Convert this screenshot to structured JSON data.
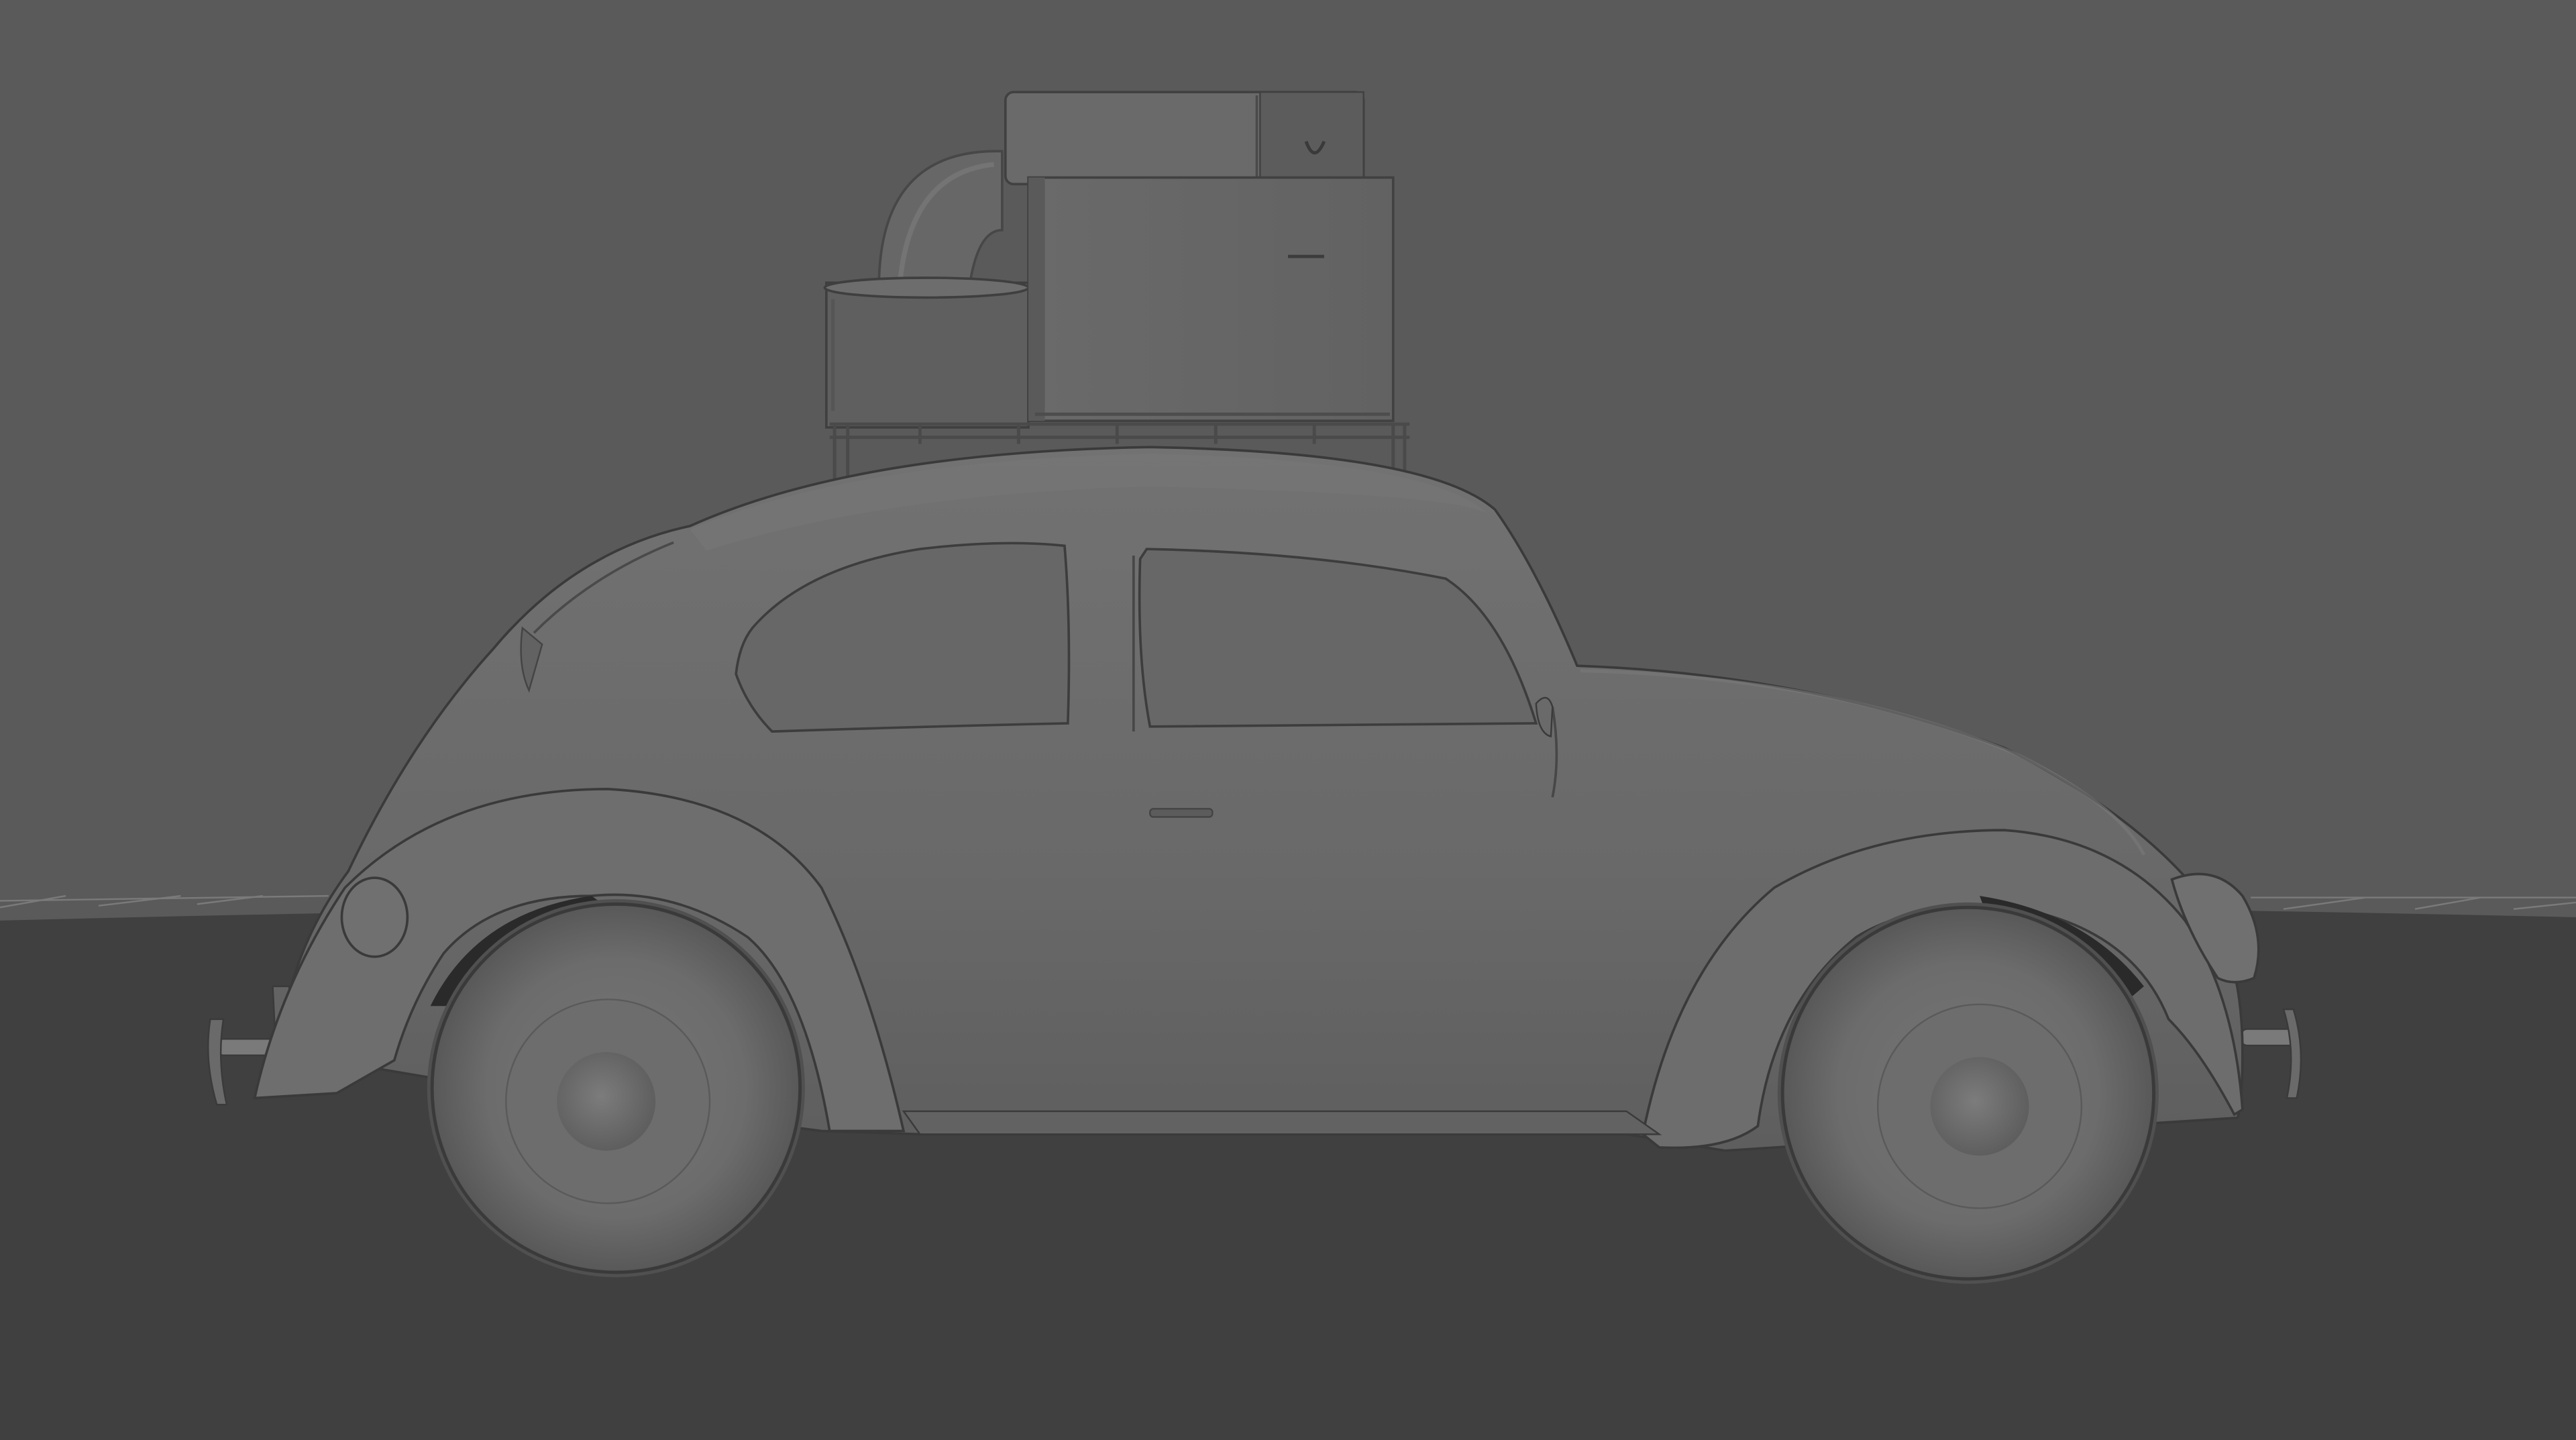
{
  "viewport": {
    "view": "side",
    "shading": "smooth-shade-all",
    "colors": {
      "background": "#5a5a5a",
      "floor": "#404040",
      "grid_line": "#7a7a7a",
      "body": "#696969",
      "body_light": "#747474",
      "body_dark": "#4b4b4b",
      "outline": "#3a3a3a",
      "window": "#666666",
      "tire": "#6e6e6e",
      "luggage": "#676767",
      "luggage_side": "#5b5b5b"
    }
  },
  "scene": {
    "object": "car-model",
    "parts": [
      "car-body",
      "front-fender",
      "rear-fender",
      "door",
      "door-handle",
      "rear-window",
      "front-window",
      "headlight",
      "taillight",
      "front-bumper",
      "rear-bumper",
      "rear-wheel",
      "front-wheel",
      "roof-rack",
      "round-luggage",
      "suitcase",
      "large-box",
      "pipe-tube"
    ]
  }
}
